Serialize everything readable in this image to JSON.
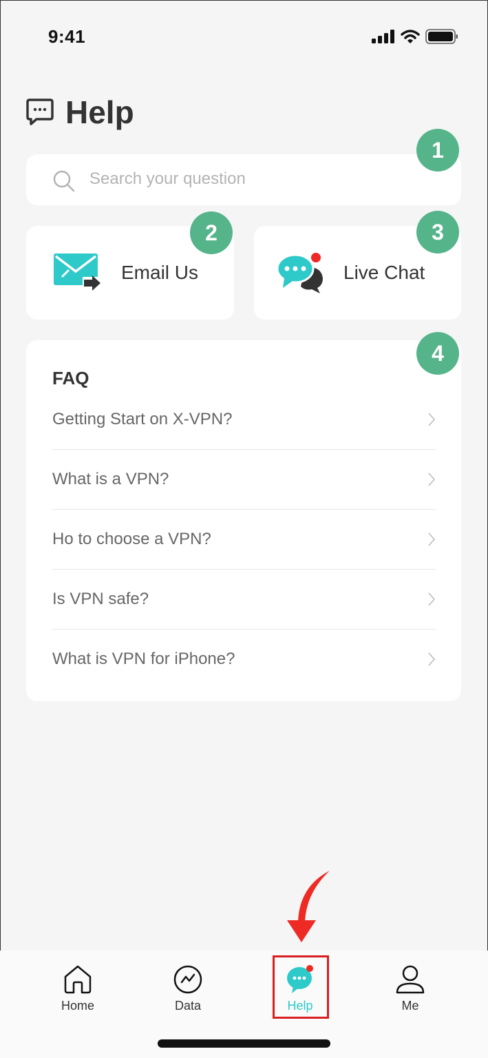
{
  "status_bar": {
    "time": "9:41",
    "icons": [
      "signal-icon",
      "wifi-icon",
      "battery-icon"
    ]
  },
  "header": {
    "icon": "chat-bubble-icon",
    "title": "Help"
  },
  "search": {
    "placeholder": "Search your question",
    "icon": "search-icon",
    "badge": "1"
  },
  "actions": [
    {
      "label": "Email Us",
      "icon": "email-send-icon",
      "badge": "2"
    },
    {
      "label": "Live Chat",
      "icon": "live-chat-icon",
      "badge": "3"
    }
  ],
  "faq": {
    "title": "FAQ",
    "badge": "4",
    "items": [
      {
        "label": "Getting Start on X-VPN?"
      },
      {
        "label": "What is a VPN?"
      },
      {
        "label": "Ho to choose a VPN?"
      },
      {
        "label": "Is VPN safe?"
      },
      {
        "label": "What is VPN for iPhone?"
      }
    ]
  },
  "tabbar": {
    "items": [
      {
        "label": "Home",
        "icon": "home-icon",
        "active": false
      },
      {
        "label": "Data",
        "icon": "chart-icon",
        "active": false
      },
      {
        "label": "Help",
        "icon": "help-chat-icon",
        "active": true
      },
      {
        "label": "Me",
        "icon": "user-icon",
        "active": false
      }
    ]
  },
  "colors": {
    "badge": "#55b48a",
    "accent": "#2ec9c9",
    "notification_dot": "#ee2a24",
    "annotation_red": "#d81e1e"
  }
}
